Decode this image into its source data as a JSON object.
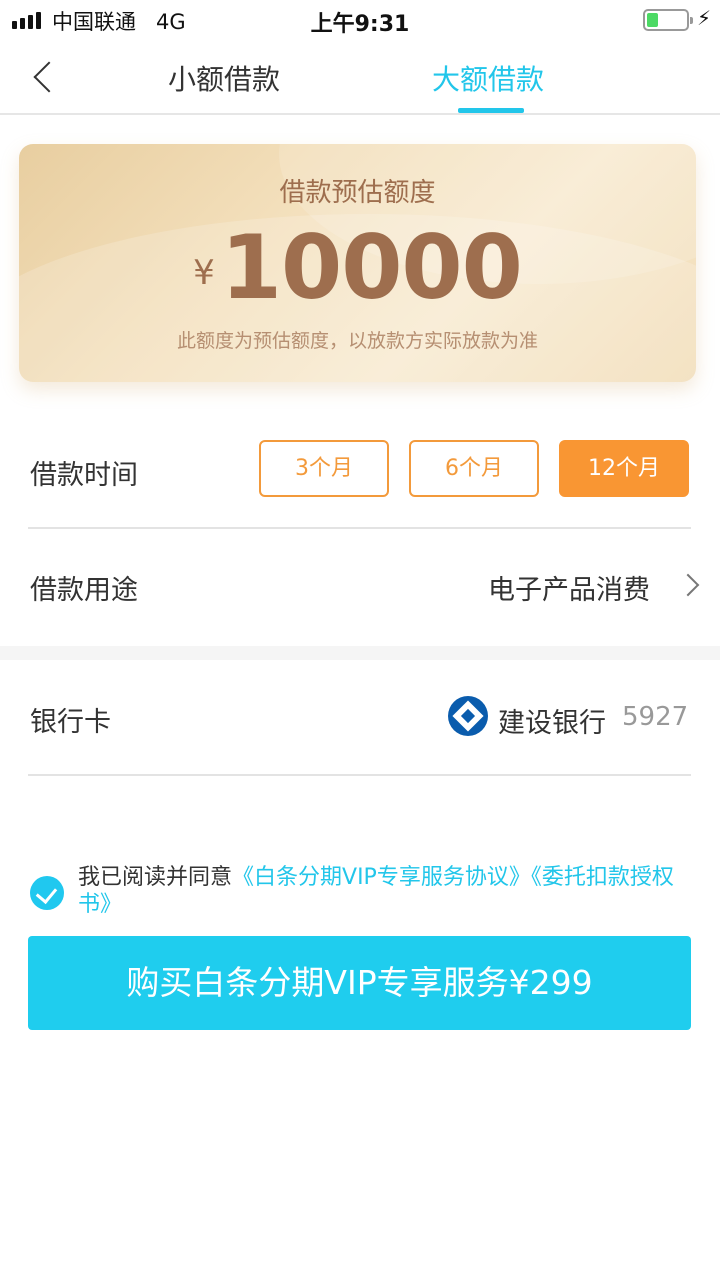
{
  "status_bar": {
    "carrier": "中国联通",
    "network": "4G",
    "time": "上午9:31",
    "battery_level": 0.3
  },
  "nav": {
    "back_icon": "chevron-left-icon",
    "tabs": [
      {
        "label": "小额借款",
        "active": false
      },
      {
        "label": "大额借款",
        "active": true
      }
    ]
  },
  "card": {
    "title": "借款预估额度",
    "currency": "¥",
    "amount": "10000",
    "note": "此额度为预估额度，以放款方实际放款为准"
  },
  "loan_term": {
    "label": "借款时间",
    "options": [
      "3个月",
      "6个月",
      "12个月"
    ],
    "selected": "12个月"
  },
  "loan_purpose": {
    "label": "借款用途",
    "value": "电子产品消费"
  },
  "bank_card": {
    "label": "银行卡",
    "bank_name": "建设银行",
    "card_tail": "5927"
  },
  "agreement": {
    "checked": true,
    "prefix": "我已阅读并同意",
    "link1": "《白条分期VIP专享服务协议》",
    "link2": "《委托扣款授权书》"
  },
  "buy_button": {
    "label": "购买白条分期VIP专享服务¥299"
  },
  "colors": {
    "accent": "#22c6ea",
    "orange": "#f99633",
    "card_text": "#9e6e4e"
  }
}
